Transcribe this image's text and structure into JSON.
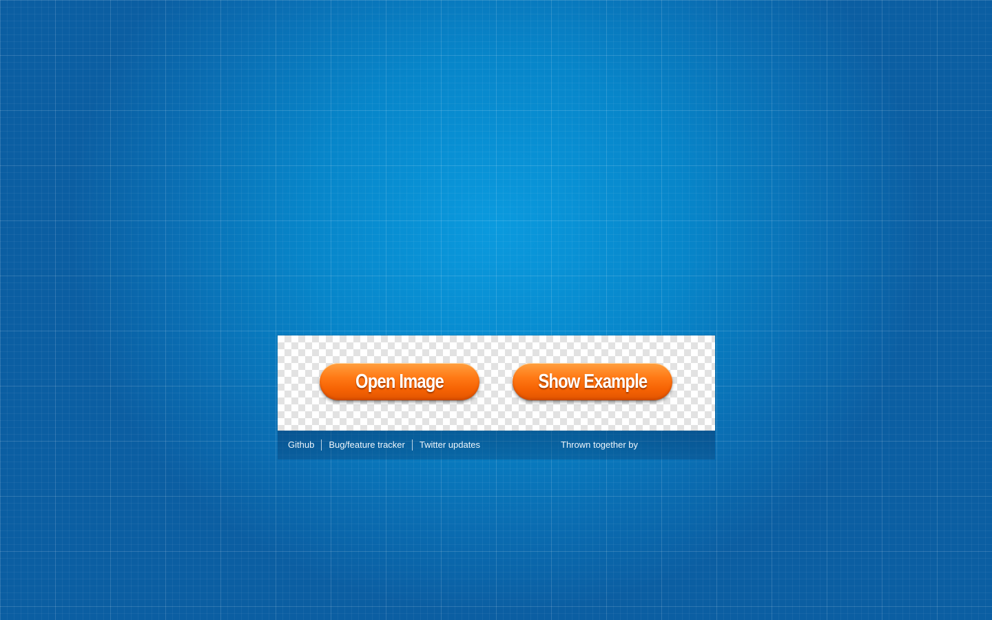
{
  "panel": {
    "open_button_label": "Open Image",
    "example_button_label": "Show Example"
  },
  "footer": {
    "links": [
      {
        "label": "Github"
      },
      {
        "label": "Bug/feature tracker"
      },
      {
        "label": "Twitter updates"
      }
    ],
    "credit_text": "Thrown together by"
  },
  "colors": {
    "background_blue": "#0a85c9",
    "button_orange": "#ff7a16"
  }
}
